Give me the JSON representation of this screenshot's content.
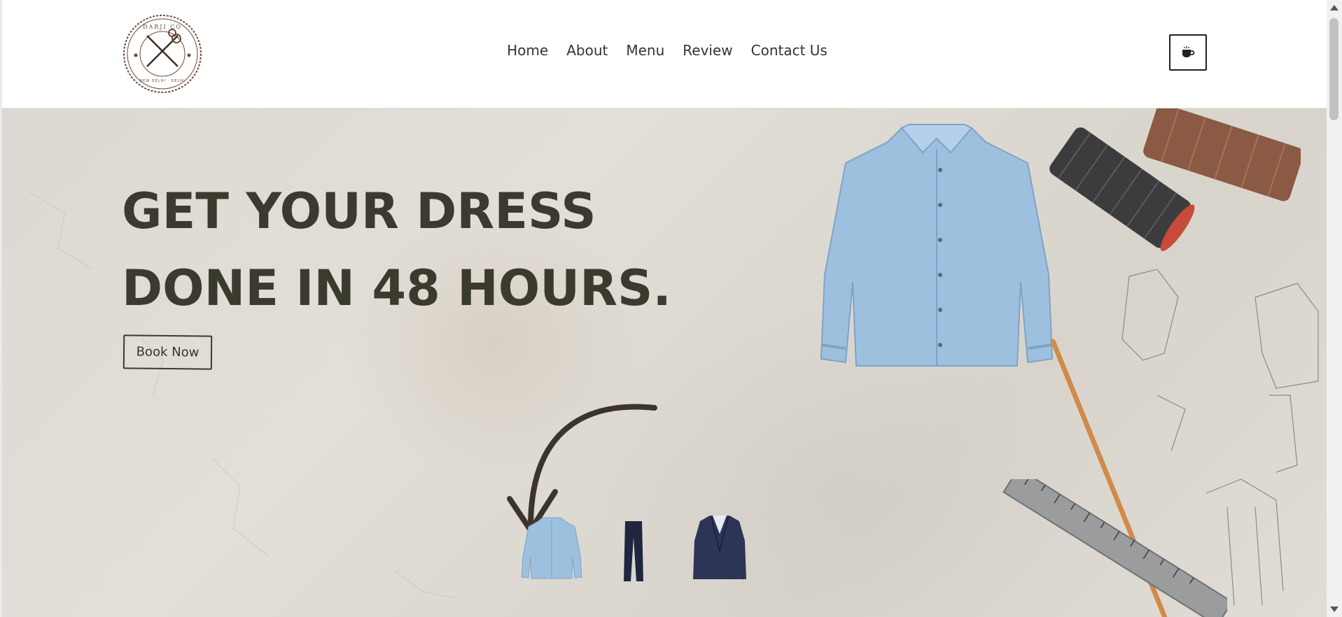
{
  "brand": {
    "logo_top_text": "DARJI CO",
    "logo_bottom_text": "NEW DELHI · DELHI"
  },
  "nav": {
    "items": [
      "Home",
      "About",
      "Menu",
      "Review",
      "Contact Us"
    ]
  },
  "cart_icon": "coffee-cup-icon",
  "hero": {
    "title_line1": "GET YOUR DRESS",
    "title_line2": "DONE IN 48 HOURS.",
    "book_label": "Book Now"
  },
  "colors": {
    "text_dark": "#3b3a2e",
    "hero_bg": "#dcd9d2",
    "shirt_blue": "#9ec0df",
    "navy": "#2c3556",
    "logo_brown": "#6b4a3a"
  }
}
